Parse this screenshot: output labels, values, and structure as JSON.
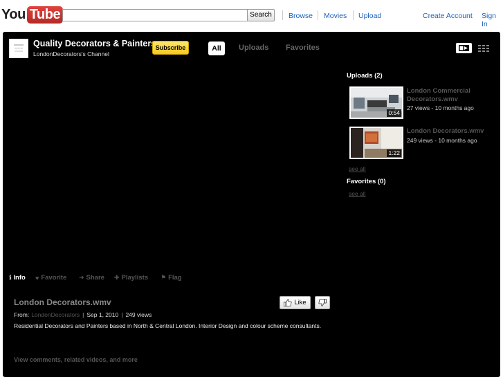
{
  "masthead": {
    "logo_you": "You",
    "logo_tube": "Tube",
    "search": {
      "value": "",
      "placeholder": "",
      "button_label": "Search"
    },
    "nav": {
      "browse": "Browse",
      "movies": "Movies",
      "upload": "Upload"
    },
    "account": {
      "create": "Create Account",
      "signin": "Sign In"
    }
  },
  "channel": {
    "title": "Quality Decorators & Painters",
    "subtitle": "LondonDecorators's Channel",
    "subscribe_label": "Subscribe",
    "tabs": {
      "all": "All",
      "uploads": "Uploads",
      "favorites": "Favorites"
    }
  },
  "sidebar": {
    "uploads_heading": "Uploads (2)",
    "videos": [
      {
        "title": "London Commercial Decorators.wmv",
        "duration": "0:54",
        "meta": "27 views - 10 months ago"
      },
      {
        "title": "London Decorators.wmv",
        "duration": "1:22",
        "meta": "249 views - 10 months ago"
      }
    ],
    "see_all_uploads": "see all",
    "favorites_heading": "Favorites (0)",
    "see_all_favorites": "see all"
  },
  "actions": {
    "info": "Info",
    "favorite": "Favorite",
    "share": "Share",
    "playlists": "Playlists",
    "flag": "Flag"
  },
  "video": {
    "title": "London Decorators.wmv",
    "like_label": "Like",
    "from_label": "From:",
    "from_user": "LondonDecorators",
    "date": "Sep 1, 2010",
    "views": "249 views",
    "description": "Residential Decorators and Painters based in North & Central London. Interior Design and colour scheme consultants.",
    "more_link": "View comments, related videos, and more"
  },
  "colors": {
    "link_blue": "#1c62b9",
    "subscribe_yellow": "#f7c91f",
    "channel_bg": "#000000",
    "logo_red": "#c4302b"
  }
}
